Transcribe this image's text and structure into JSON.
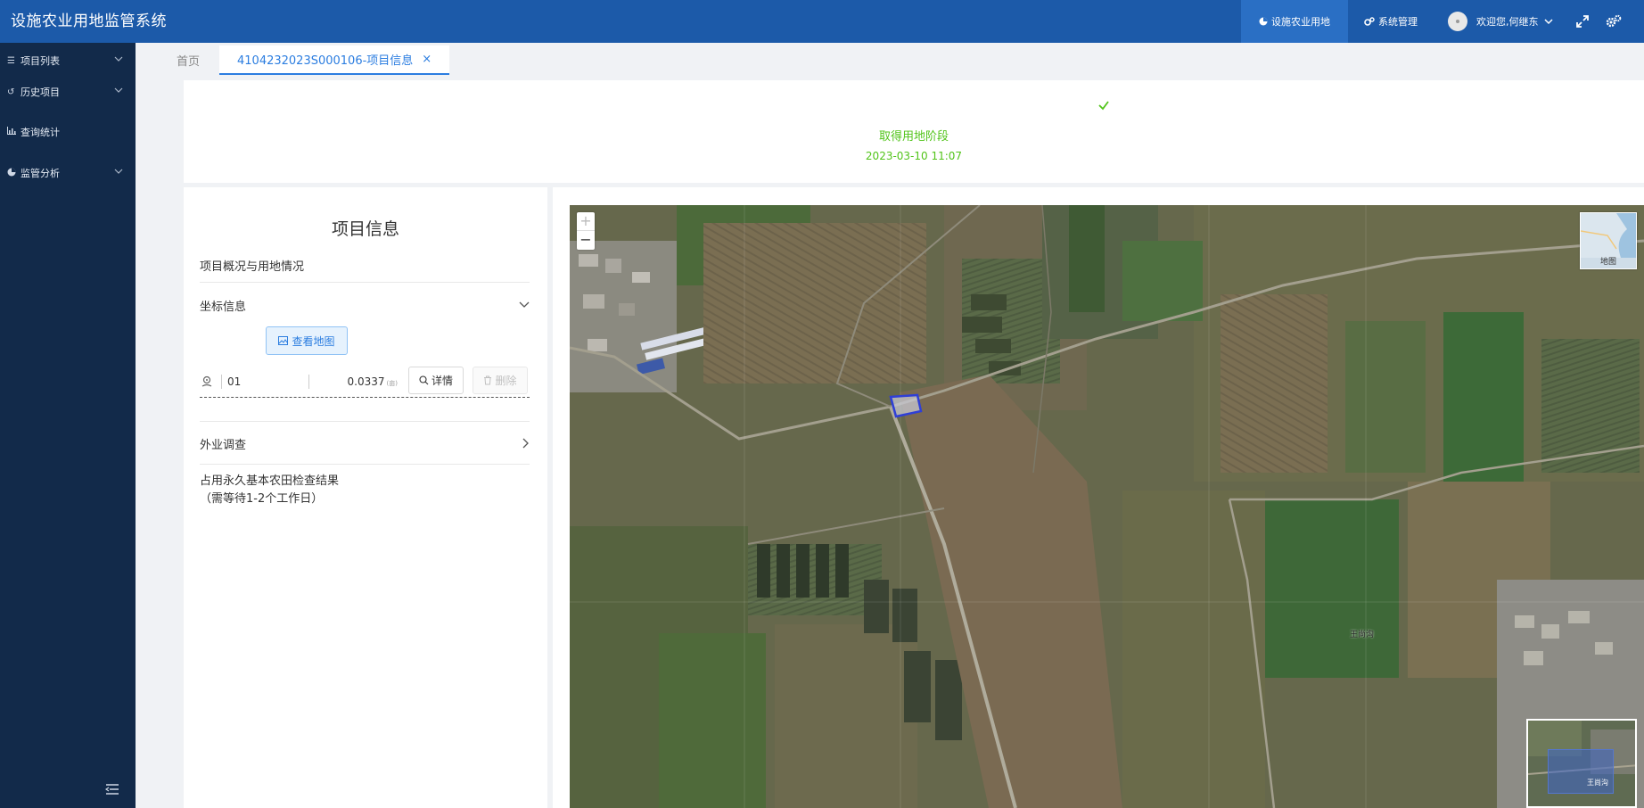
{
  "header": {
    "title": "设施农业用地监管系统",
    "nav_items": [
      {
        "label": "设施农业用地",
        "icon": "pie-chart-icon",
        "active": true
      },
      {
        "label": "系统管理",
        "icon": "gears-icon",
        "active": false
      }
    ],
    "user_greeting": "欢迎您,何继东",
    "icons": [
      "avatar",
      "chevron-down-icon",
      "fullscreen-icon",
      "settings-icon"
    ]
  },
  "sidebar": {
    "items": [
      {
        "label": "项目列表",
        "icon": "list-icon",
        "expandable": true
      },
      {
        "label": "历史项目",
        "icon": "history-icon",
        "expandable": true
      },
      {
        "label": "查询统计",
        "icon": "bar-chart-icon",
        "expandable": false
      },
      {
        "label": "监管分析",
        "icon": "pie-chart-icon",
        "expandable": true
      }
    ]
  },
  "tabs": [
    {
      "label": "首页",
      "active": false
    },
    {
      "label": "4104232023S000106-项目信息",
      "active": true,
      "closable": true
    }
  ],
  "stage": {
    "label": "取得用地阶段",
    "date": "2023-03-10 11:07",
    "status_color": "#52c41a"
  },
  "info_panel": {
    "title": "项目信息",
    "overview_label": "项目概况与用地情况",
    "coord_label": "坐标信息",
    "view_map_label": "查看地图",
    "coord_row": {
      "id": "01",
      "area": "0.0337",
      "area_unit": "(亩)",
      "detail_label": "详情",
      "delete_label": "删除"
    },
    "survey_label": "外业调查",
    "farmland_check_label": "占用永久基本农田检查结果",
    "farmland_check_note": "（需等待1-2个工作日）"
  },
  "map": {
    "zoom_in": "+",
    "zoom_out": "−",
    "basemap_label": "地图",
    "place_label": "王尚沟",
    "overview_label": "王尚沟",
    "parcel_color": "#2f3fd6"
  },
  "colors": {
    "header_bg": "#1c5aa9",
    "sidebar_bg": "#122a4a",
    "accent": "#2b7de0"
  }
}
